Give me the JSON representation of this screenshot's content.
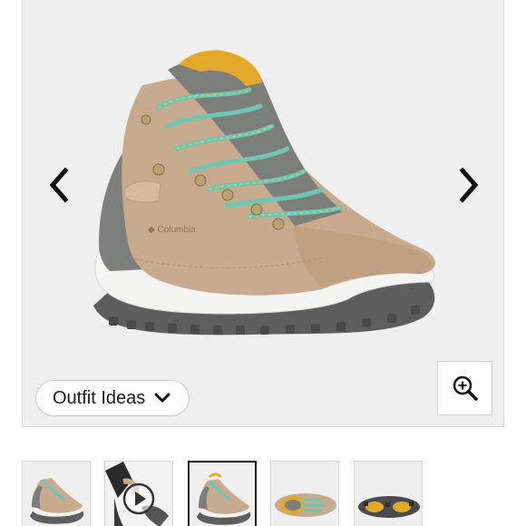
{
  "gallery": {
    "outfit_button_label": "Outfit Ideas",
    "prev_icon": "chevron-left-icon",
    "next_icon": "chevron-right-icon",
    "zoom_icon": "zoom-in-icon",
    "outfit_icon": "chevron-down-icon"
  },
  "thumbnails": {
    "count": 5,
    "active_index": 2,
    "video_icon": "play-icon"
  },
  "colors": {
    "suede": "#c8ab8e",
    "lace": "#6fc6b3",
    "accent_yellow": "#e3a92a",
    "gray_panel": "#7d7f7d",
    "sole_white": "#f4f4f2",
    "outsole": "#5e5e5e"
  }
}
